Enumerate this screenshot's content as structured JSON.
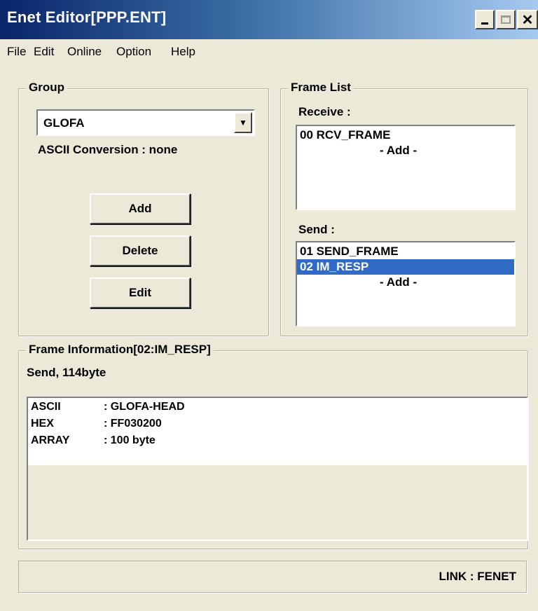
{
  "window": {
    "title": "Enet Editor[PPP.ENT]"
  },
  "menu": {
    "items": [
      "File",
      "Edit",
      "Online",
      "Option",
      "Help"
    ]
  },
  "group": {
    "title": "Group",
    "selected": "GLOFA",
    "ascii_conversion": "ASCII Conversion : none",
    "buttons": {
      "add": "Add",
      "delete": "Delete",
      "edit": "Edit"
    }
  },
  "frame_list": {
    "title": "Frame List",
    "receive_label": "Receive :",
    "receive_items": [
      "00 RCV_FRAME",
      "- Add -"
    ],
    "send_label": "Send :",
    "send_items": [
      "01 SEND_FRAME",
      "02 IM_RESP",
      "- Add -"
    ],
    "selected_send": "02 IM_RESP"
  },
  "frame_info": {
    "title": "Frame Information[02:IM_RESP]",
    "summary": "Send, 114byte",
    "lines": [
      {
        "key": "ASCII",
        "value": ": GLOFA-HEAD"
      },
      {
        "key": "HEX",
        "value": ": FF030200"
      },
      {
        "key": "ARRAY",
        "value": ": 100 byte"
      }
    ]
  },
  "status": {
    "text": "LINK : FENET"
  },
  "colors": {
    "title_start": "#0a246a",
    "title_end": "#a6caf0",
    "selection": "#316ac5",
    "face": "#ece9d8"
  }
}
